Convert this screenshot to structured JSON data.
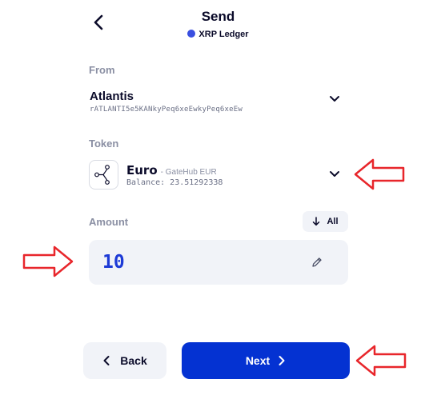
{
  "header": {
    "title": "Send",
    "network": "XRP Ledger",
    "network_dot_color": "#3a4fe0",
    "back_icon": "chevron-left-icon"
  },
  "from": {
    "label": "From",
    "account_name": "Atlantis",
    "account_address": "rATLANTI5e5KANkyPeq6xeEwkyPeq6xeEw"
  },
  "token": {
    "label": "Token",
    "name": "Euro",
    "issuer": "- GateHub EUR",
    "balance": "Balance: 23.51292338"
  },
  "amount": {
    "label": "Amount",
    "all_label": "All",
    "value": "10"
  },
  "footer": {
    "back_label": "Back",
    "next_label": "Next"
  },
  "annotations": {
    "arrow_color": "#e8262b"
  },
  "colors": {
    "primary": "#0432d2",
    "amount_text": "#1d3ad6",
    "field_bg": "#f1f3f8"
  }
}
